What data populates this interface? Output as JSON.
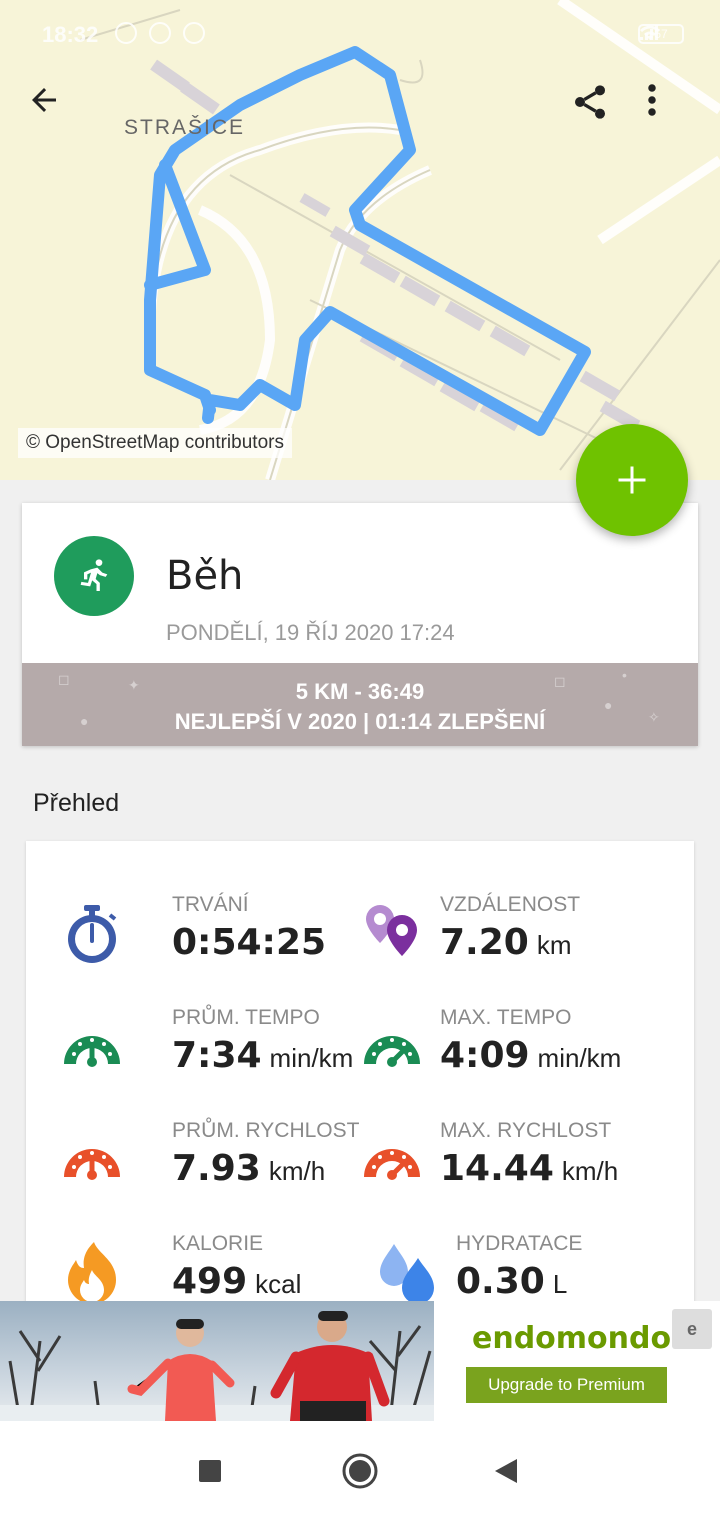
{
  "status_bar": {
    "time": "18:32",
    "battery": "57"
  },
  "map": {
    "attribution": "© OpenStreetMap contributors",
    "place_label": "STRAŠICE",
    "route_color": "#5aa6f5"
  },
  "toolbar": {
    "back_icon": "arrow-left-icon",
    "share_icon": "share-icon",
    "more_icon": "more-vert-icon"
  },
  "fab": {
    "icon": "plus-icon",
    "color": "#6fc200"
  },
  "workout": {
    "sport": "Běh",
    "date": "PONDĚLÍ, 19 ŘÍJ 2020 17:24",
    "best_line1": "5 KM  -  36:49",
    "best_line2": "NEJLEPŠÍ V 2020  |  01:14 ZLEPŠENÍ",
    "avatar_color": "#1f9c5c"
  },
  "overview": {
    "title": "Přehled",
    "stats": [
      {
        "label": "TRVÁNÍ",
        "value": "0:54:25",
        "unit": ""
      },
      {
        "label": "VZDÁLENOST",
        "value": "7.20",
        "unit": "km"
      },
      {
        "label": "PRŮM. TEMPO",
        "value": "7:34",
        "unit": "min/km"
      },
      {
        "label": "MAX. TEMPO",
        "value": "4:09",
        "unit": "min/km"
      },
      {
        "label": "PRŮM. RYCHLOST",
        "value": "7.93",
        "unit": "km/h"
      },
      {
        "label": "MAX. RYCHLOST",
        "value": "14.44",
        "unit": "km/h"
      },
      {
        "label": "KALORIE",
        "value": "499",
        "unit": "kcal"
      },
      {
        "label": "HYDRATACE",
        "value": "0.30",
        "unit": "L"
      }
    ]
  },
  "ad": {
    "brand": "endomondo",
    "cta": "Upgrade to Premium"
  }
}
